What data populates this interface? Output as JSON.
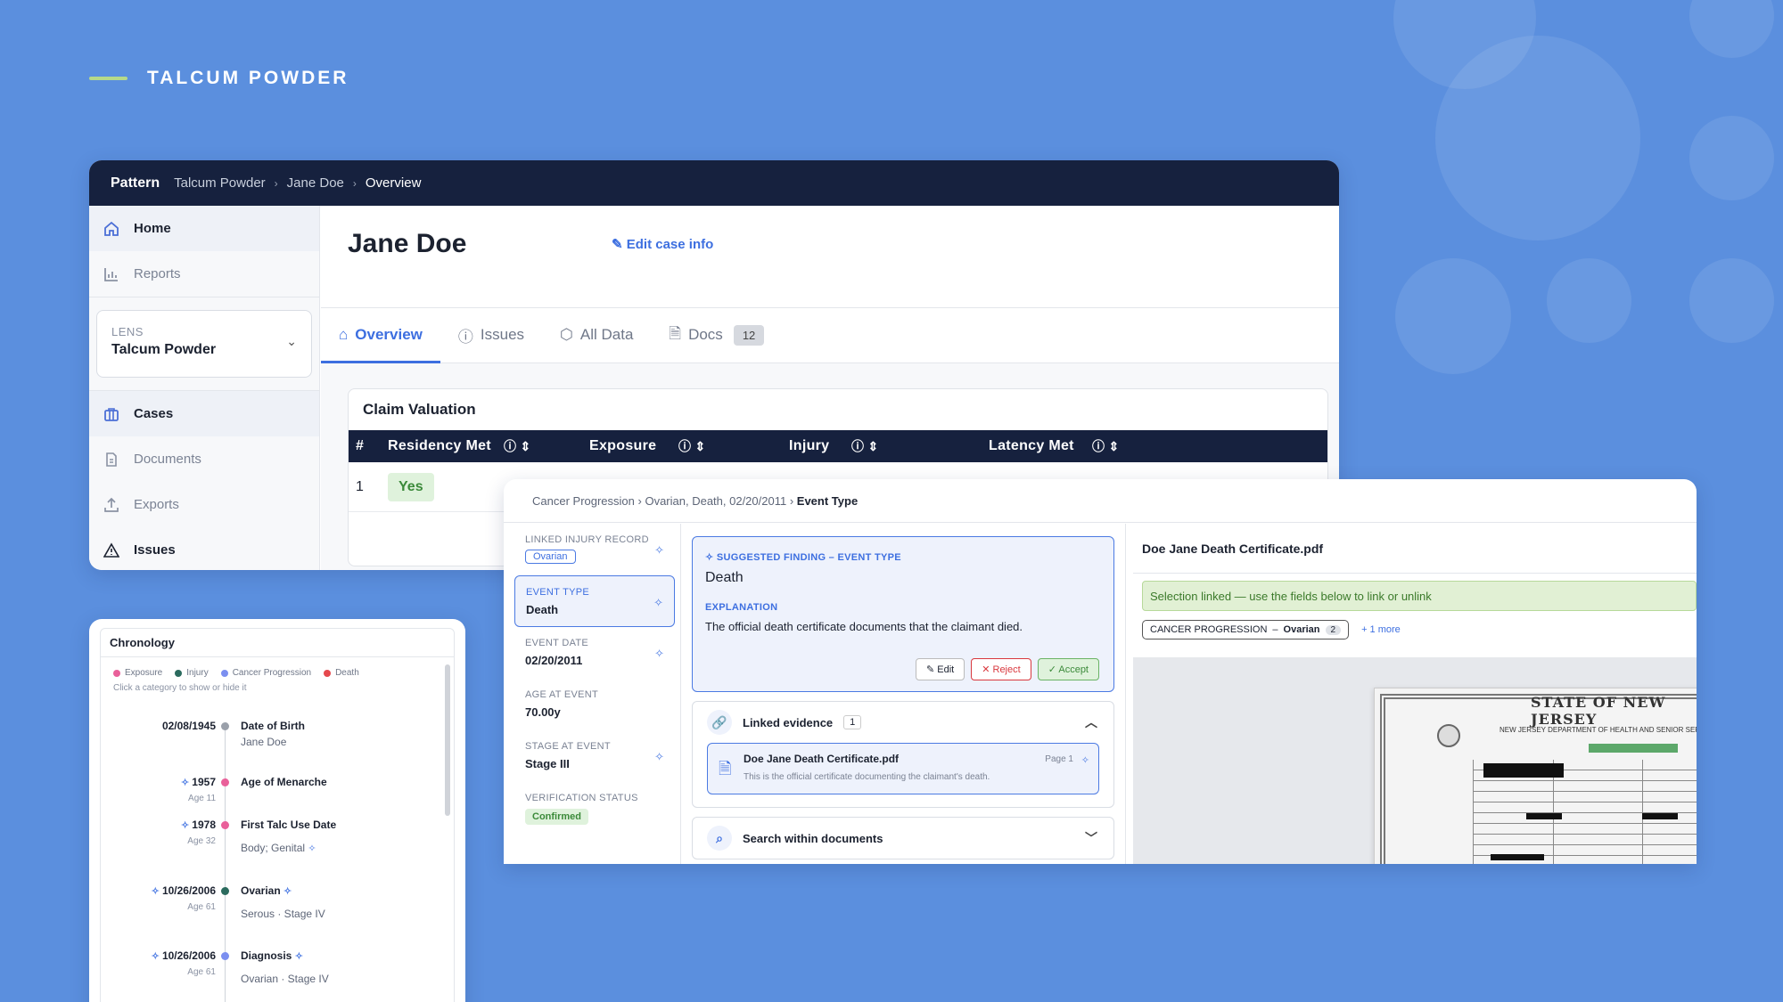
{
  "header": {
    "title": "TALCUM POWDER"
  },
  "topbar": {
    "brand": "Pattern",
    "crumbs": [
      "Talcum Powder",
      "Jane Doe",
      "Overview"
    ]
  },
  "sidebar": {
    "items_top": [
      {
        "label": "Home",
        "icon": "home-icon"
      },
      {
        "label": "Reports",
        "icon": "bar-chart-icon"
      }
    ],
    "lens": {
      "label": "LENS",
      "value": "Talcum Powder"
    },
    "items_bottom": [
      {
        "label": "Cases",
        "icon": "briefcase-icon"
      },
      {
        "label": "Documents",
        "icon": "document-icon"
      },
      {
        "label": "Exports",
        "icon": "upload-icon"
      },
      {
        "label": "Issues",
        "icon": "warning-icon"
      }
    ]
  },
  "case": {
    "name": "Jane Doe",
    "edit_label": "Edit case info"
  },
  "tabs": [
    {
      "label": "Overview"
    },
    {
      "label": "Issues"
    },
    {
      "label": "All Data"
    },
    {
      "label": "Docs",
      "badge": "12"
    }
  ],
  "claim": {
    "title": "Claim Valuation",
    "columns": [
      "#",
      "Residency Met",
      "Exposure",
      "Injury",
      "Latency Met"
    ],
    "row": {
      "num": "1",
      "residency": "Yes"
    }
  },
  "event_panel": {
    "breadcrumb": [
      "Cancer Progression",
      "Ovarian, Death, 02/20/2011"
    ],
    "breadcrumb_current": "Event Type",
    "fields": {
      "linked_injury": {
        "label": "LINKED INJURY RECORD",
        "value": "Ovarian"
      },
      "event_type": {
        "label": "EVENT TYPE",
        "value": "Death"
      },
      "event_date": {
        "label": "EVENT DATE",
        "value": "02/20/2011"
      },
      "age": {
        "label": "AGE AT EVENT",
        "value": "70.00y"
      },
      "stage": {
        "label": "STAGE AT EVENT",
        "value": "Stage III"
      },
      "verification": {
        "label": "VERIFICATION STATUS",
        "value": "Confirmed"
      }
    },
    "suggestion": {
      "label": "SUGGESTED FINDING – EVENT TYPE",
      "value": "Death",
      "explanation_label": "EXPLANATION",
      "explanation": "The official death certificate documents that the claimant died.",
      "edit": "Edit",
      "reject": "Reject",
      "accept": "Accept"
    },
    "linked_evidence": {
      "label": "Linked evidence",
      "count": "1",
      "doc_name": "Doe Jane Death Certificate.pdf",
      "doc_page": "Page 1",
      "doc_desc": "This is the official certificate documenting the claimant's death."
    },
    "search": {
      "label": "Search within documents"
    },
    "viewer": {
      "file": "Doe Jane Death Certificate.pdf",
      "linked_msg": "Selection linked — use the fields below to link or unlink",
      "chip_category": "CANCER PROGRESSION",
      "chip_value": "Ovarian",
      "chip_count": "2",
      "more": "+ 1 more",
      "cert_title": "STATE OF NEW JERSEY",
      "cert_sub": "NEW JERSEY DEPARTMENT OF HEALTH AND SENIOR SERVICES"
    }
  },
  "chronology": {
    "title": "Chronology",
    "legend": [
      {
        "label": "Exposure",
        "color": "#e9609a"
      },
      {
        "label": "Injury",
        "color": "#2b6b5e"
      },
      {
        "label": "Cancer Progression",
        "color": "#7b8ff0"
      },
      {
        "label": "Death",
        "color": "#e5484d"
      }
    ],
    "hint": "Click a category to show or hide it",
    "events": [
      {
        "date": "02/08/1945",
        "age": "",
        "title": "Date of Birth",
        "sub": "Jane Doe",
        "color": "#9aa0aa",
        "spark": false
      },
      {
        "date": "1957",
        "age": "Age 11",
        "title": "Age of Menarche",
        "sub": "",
        "color": "#e9609a",
        "spark": true
      },
      {
        "date": "1978",
        "age": "Age 32",
        "title": "First Talc Use Date",
        "sub": "Body; Genital",
        "color": "#e9609a",
        "spark": true
      },
      {
        "date": "10/26/2006",
        "age": "Age 61",
        "title": "Ovarian",
        "sub": "Serous · Stage IV",
        "color": "#2b6b5e",
        "spark": true
      },
      {
        "date": "10/26/2006",
        "age": "Age 61",
        "title": "Diagnosis",
        "sub": "Ovarian · Stage IV",
        "color": "#7b8ff0",
        "spark": true
      }
    ]
  }
}
